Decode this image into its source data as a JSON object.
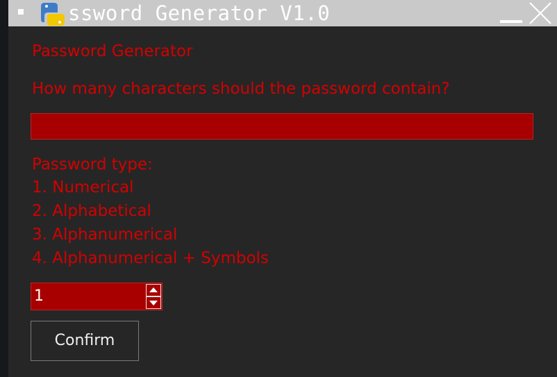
{
  "window": {
    "title": "ssword Generator V1.0",
    "menu_icon": "window-menu-icon",
    "logo_icon": "python-logo-icon",
    "minimize_icon": "minimize-icon",
    "close_icon": "close-icon"
  },
  "form": {
    "heading": "Password Generator",
    "length_prompt": "How many characters should the password contain?",
    "length_value": "",
    "type_label": "Password type:",
    "type_options": [
      "1. Numerical",
      "2. Alphabetical",
      "3. Alphanumerical",
      "4. Alphanumerical + Symbols"
    ],
    "type_value": "1",
    "confirm_label": "Confirm"
  },
  "colors": {
    "titlebar": "#c9c9c9",
    "window_bg": "#262626",
    "accent_red": "#d40000",
    "field_red": "#a80000",
    "button_text": "#f0f0f0"
  }
}
